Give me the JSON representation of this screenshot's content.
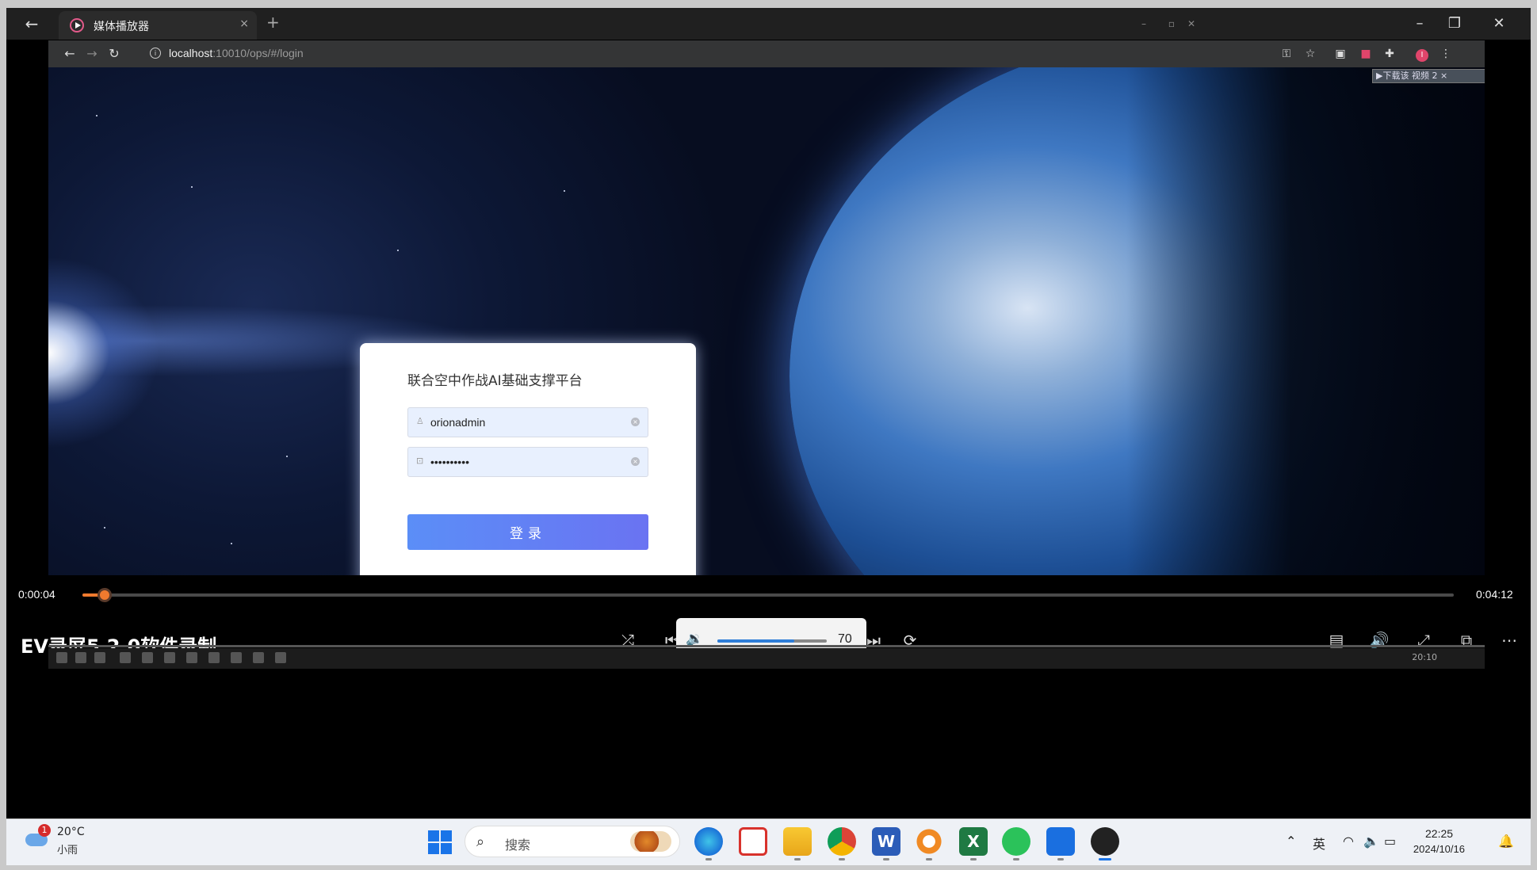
{
  "player": {
    "tab_title": "媒体播放器",
    "tab_close": "×",
    "new_tab": "+",
    "current_time": "0:00:04",
    "total_time": "0:04:12",
    "progress": 0.016,
    "watermark": "EV录屏5.2.0软件录制",
    "volume": {
      "value": 70,
      "label": "70"
    },
    "mini_clock": "20:10"
  },
  "browser": {
    "url_host": "localhost",
    "url_rest": ":10010/ops/#/login",
    "download_bar": "▶下载该 视频  2 ×",
    "profile_initial": "I"
  },
  "login": {
    "title": "联合空中作战AI基础支撑平台",
    "username": "orionadmin",
    "password": "••••••••••",
    "submit_label": "登录"
  },
  "taskbar": {
    "weather": {
      "badge": "1",
      "temp": "20°C",
      "desc": "小雨"
    },
    "search_placeholder": "搜索",
    "ime": "英",
    "time": "22:25",
    "date": "2024/10/16"
  },
  "colors": {
    "accent": "#f07a2e",
    "login_button": "#6a80f5",
    "volume_fill": "#2f7ed8"
  }
}
